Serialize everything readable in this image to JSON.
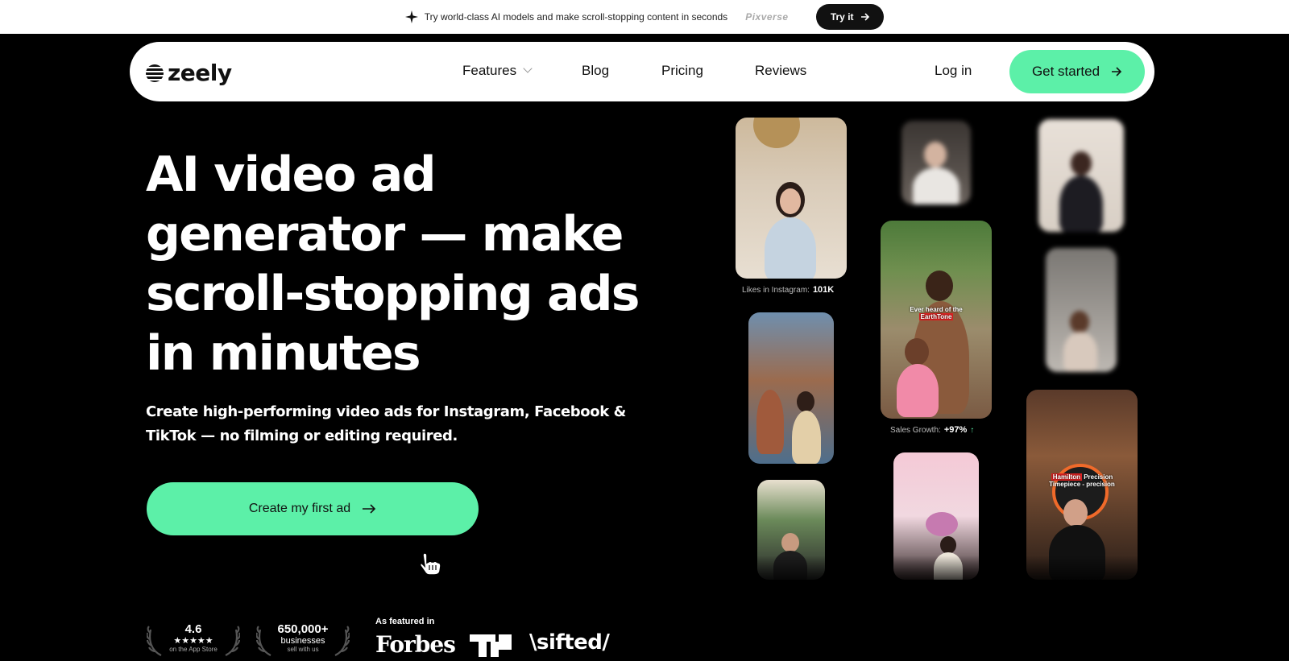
{
  "promo": {
    "text": "Try world-class AI models and make scroll-stopping content in seconds",
    "partner": "Pixverse",
    "button": "Try it"
  },
  "nav": {
    "logo": "zeely",
    "links": [
      "Features",
      "Blog",
      "Pricing",
      "Reviews"
    ],
    "login": "Log in",
    "cta": "Get started"
  },
  "hero": {
    "title": "AI video ad generator — make scroll-stopping ads in minutes",
    "subtitle": "Create high-performing video ads for Instagram, Facebook & TikTok — no filming or editing required.",
    "cta": "Create my first ad"
  },
  "badges": {
    "rating": {
      "value": "4.6",
      "stars": "★★★★★",
      "label": "on the App Store"
    },
    "businesses": {
      "value": "650,000+",
      "label": "businesses",
      "sublabel": "sell with us"
    }
  },
  "press": {
    "label": "As featured in",
    "outlets": [
      "Forbes",
      "TC",
      "\\sifted/"
    ]
  },
  "tiles": {
    "stat1": {
      "label": "Likes in Instagram:",
      "value": "101K"
    },
    "stat2": {
      "label": "Sales Growth:",
      "value": "+97%",
      "arrow": "↑"
    },
    "overlay1": {
      "line1": "Ever heard of the",
      "line2": "EarthTone"
    },
    "overlay2": {
      "red": "Hamilton",
      "line1": "Precision",
      "line2": "Timepiece - precision"
    }
  },
  "colors": {
    "accent": "#5cf0a8",
    "background": "#000000"
  }
}
